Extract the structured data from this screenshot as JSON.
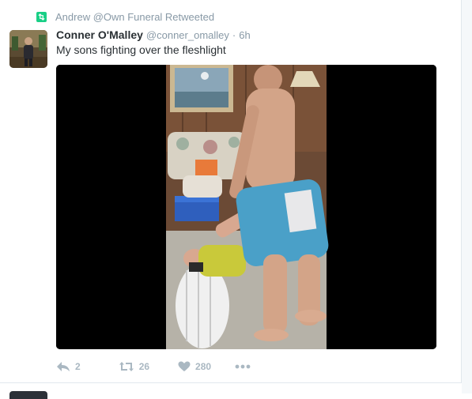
{
  "retweet_context": {
    "text": "Andrew @Own Funeral Retweeted"
  },
  "tweet": {
    "fullname": "Conner O'Malley",
    "username": "@conner_omalley",
    "separator": "·",
    "timestamp": "6h",
    "text": "My sons fighting over the fleshlight"
  },
  "actions": {
    "reply_count": "2",
    "retweet_count": "26",
    "like_count": "280"
  },
  "colors": {
    "retweet_green": "#19cf86",
    "meta_gray": "#8899a6",
    "action_gray": "#aab8c2",
    "text_dark": "#292f33"
  },
  "icons": [
    "retweet-icon",
    "reply-icon",
    "retweet-action-icon",
    "like-icon",
    "more-icon",
    "play-video"
  ]
}
